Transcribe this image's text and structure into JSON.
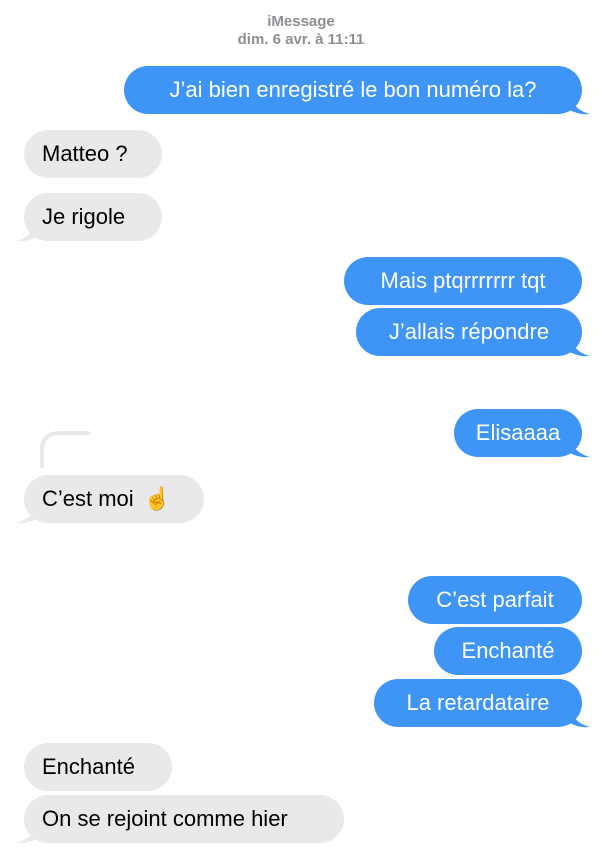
{
  "header": {
    "service": "iMessage",
    "timestamp": "dim. 6 avr. à 11:11"
  },
  "colors": {
    "sent_bubble": "#3e95f5",
    "received_bubble": "#e9e9eb",
    "meta_text": "#8e8e93"
  },
  "messages": [
    {
      "direction": "sent",
      "text": "J’ai bien enregistré le bon numéro la?"
    },
    {
      "direction": "received",
      "text": "Matteo ?"
    },
    {
      "direction": "received",
      "text": "Je rigole"
    },
    {
      "direction": "sent",
      "text": "Mais ptqrrrrrrr tqt"
    },
    {
      "direction": "sent",
      "text": "J’allais répondre"
    },
    {
      "direction": "sent",
      "text": "Elisaaaa"
    },
    {
      "direction": "received",
      "text": "C’est moi",
      "emoji": "☝️",
      "reply": true
    },
    {
      "direction": "sent",
      "text": "C’est parfait"
    },
    {
      "direction": "sent",
      "text": "Enchanté"
    },
    {
      "direction": "sent",
      "text": "La retardataire"
    },
    {
      "direction": "received",
      "text": "Enchanté"
    },
    {
      "direction": "received",
      "text": "On se rejoint comme hier"
    }
  ]
}
